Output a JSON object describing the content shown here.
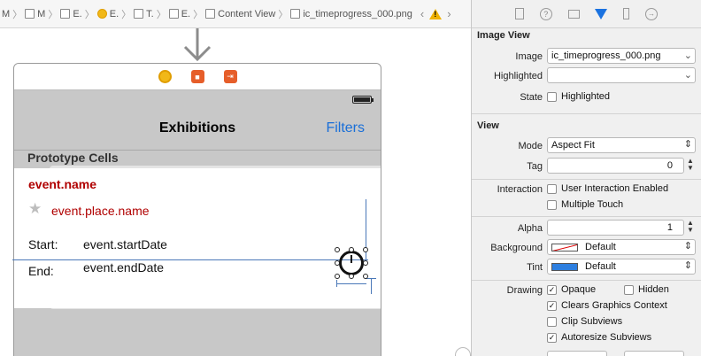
{
  "jumpbar": {
    "crumbs": [
      {
        "label": "M",
        "icon": "folder-icon"
      },
      {
        "label": "M",
        "icon": "folder-icon"
      },
      {
        "label": "E.",
        "icon": "storyboard-icon"
      },
      {
        "label": "E.",
        "icon": "scene-icon"
      },
      {
        "label": "T.",
        "icon": "table-icon"
      },
      {
        "label": "E.",
        "icon": "cell-icon"
      },
      {
        "label": "Content View",
        "icon": "view-icon"
      },
      {
        "label": "ic_timeprogress_000.png",
        "icon": "image-icon"
      }
    ],
    "warning_icon": "warning-icon"
  },
  "scene": {
    "dock_icons": [
      "view-controller-icon",
      "first-responder-icon",
      "exit-icon"
    ],
    "nav_title": "Exhibitions",
    "nav_button": "Filters",
    "section_label": "Prototype Cells",
    "cell": {
      "name": "event.name",
      "place": "event.place.name",
      "start_label": "Start:",
      "start_value": "event.startDate",
      "end_label": "End:",
      "end_value": "event.endDate"
    },
    "colors": {
      "accent_red": "#b00000",
      "link_blue": "#1a6fd8",
      "guide_blue": "#4a78b8"
    }
  },
  "inspector": {
    "tabs": [
      "file-inspector-icon",
      "help-icon",
      "identity-inspector-icon",
      "attributes-inspector-icon",
      "size-inspector-icon",
      "connections-inspector-icon"
    ],
    "image_view": {
      "title": "Image View",
      "image_label": "Image",
      "image_value": "ic_timeprogress_000.png",
      "highlighted_label": "Highlighted",
      "highlighted_value": "",
      "state_label": "State",
      "state_check": "Highlighted",
      "state_checked": false
    },
    "view": {
      "title": "View",
      "mode_label": "Mode",
      "mode_value": "Aspect Fit",
      "tag_label": "Tag",
      "tag_value": "0",
      "interaction_label": "Interaction",
      "user_interaction": "User Interaction Enabled",
      "multiple_touch": "Multiple Touch",
      "alpha_label": "Alpha",
      "alpha_value": "1",
      "background_label": "Background",
      "background_value": "Default",
      "tint_label": "Tint",
      "tint_value": "Default",
      "drawing_label": "Drawing",
      "opaque": "Opaque",
      "hidden": "Hidden",
      "clears": "Clears Graphics Context",
      "clip": "Clip Subviews",
      "autoresize": "Autoresize Subviews"
    }
  }
}
